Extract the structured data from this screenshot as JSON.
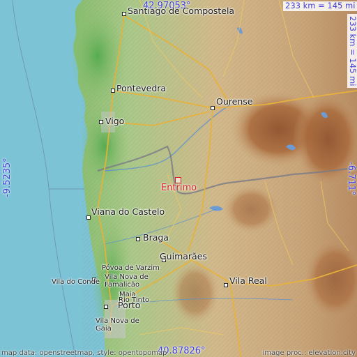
{
  "map": {
    "target": {
      "name": "Entrimo"
    },
    "cities": [
      {
        "key": "santiago",
        "name": "Santiago de Compostela"
      },
      {
        "key": "pontevedra",
        "name": "Pontevedra"
      },
      {
        "key": "ourense",
        "name": "Ourense"
      },
      {
        "key": "vigo",
        "name": "Vigo"
      },
      {
        "key": "viana",
        "name": "Viana do Castelo"
      },
      {
        "key": "braga",
        "name": "Braga"
      },
      {
        "key": "guimaraes",
        "name": "Guimarães"
      },
      {
        "key": "povoa",
        "name": "Póvoa de Varzim"
      },
      {
        "key": "vilanova_famalicao",
        "name": "Vila Nova de Famalicão"
      },
      {
        "key": "vila_conde",
        "name": "Vila do Conde"
      },
      {
        "key": "maia",
        "name": "Maia"
      },
      {
        "key": "rio_tinto",
        "name": "Rio Tinto"
      },
      {
        "key": "porto",
        "name": "Porto"
      },
      {
        "key": "vng",
        "name": "Vila Nova de Gaia"
      },
      {
        "key": "vila_real",
        "name": "Vila Real"
      }
    ],
    "coordinates": {
      "top_lat": "42.97053°",
      "bottom_lat": "40.87826°",
      "left_lon": "-9.5235°",
      "right_lon": "-6.711°"
    },
    "scale": {
      "horizontal": "233 km = 145 mi",
      "vertical": "233 km = 145 mi"
    },
    "footer": {
      "left": "map data: openstreetmap, style: opentopomap",
      "right": "image proc.: elevation.city"
    }
  }
}
